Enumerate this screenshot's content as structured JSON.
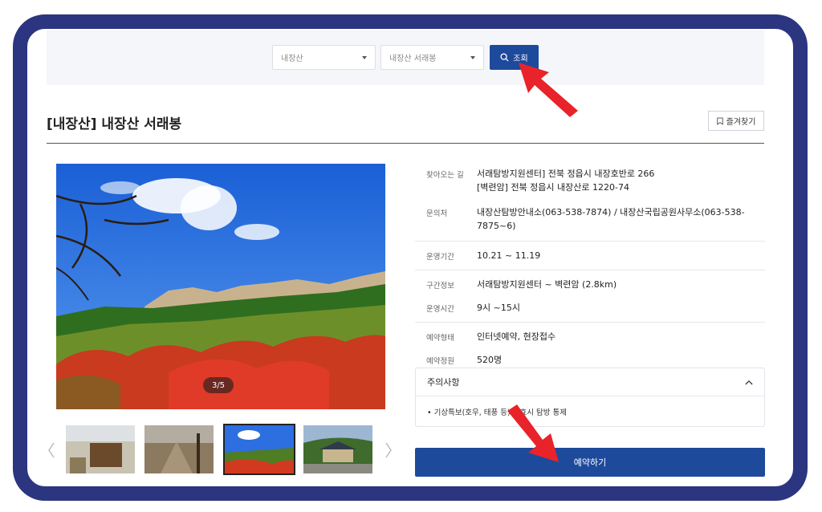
{
  "search": {
    "mountain_select": "내장산",
    "peak_select": "내장산 서래봉",
    "search_button": "조회"
  },
  "page": {
    "title": "[내장산] 내장산 서래봉",
    "favorite_button": "즐겨찾기"
  },
  "gallery": {
    "counter": "3/5",
    "thumbnails": 4
  },
  "info": {
    "directions_label": "찾아오는 길",
    "directions_value_1": "서래탐방지원센터] 전북 정읍시 내장호반로 266",
    "directions_value_2": "[벽련암] 전북 정읍시 내장산로 1220-74",
    "contact_label": "문의처",
    "contact_value": "내장산탐방안내소(063-538-7874) / 내장산국립공원사무소(063-538-7875~6)",
    "period_label": "운영기간",
    "period_value": "10.21 ~ 11.19",
    "section_label": "구간정보",
    "section_value": "서래탐방지원센터 ~ 벽련암 (2.8km)",
    "hours_label": "운영시간",
    "hours_value": "9시 ~15시",
    "type_label": "예약형태",
    "type_value": "인터넷예약, 현장접수",
    "capacity_label": "예약정원",
    "capacity_value": "520명"
  },
  "notice": {
    "title": "주의사항",
    "item": "기상특보(호우, 태풍 등) 발효시 탐방 통제"
  },
  "reserve_button": "예약하기",
  "colors": {
    "frame": "#2c3580",
    "primary": "#1e4a9c",
    "pointer": "#e8232a"
  }
}
